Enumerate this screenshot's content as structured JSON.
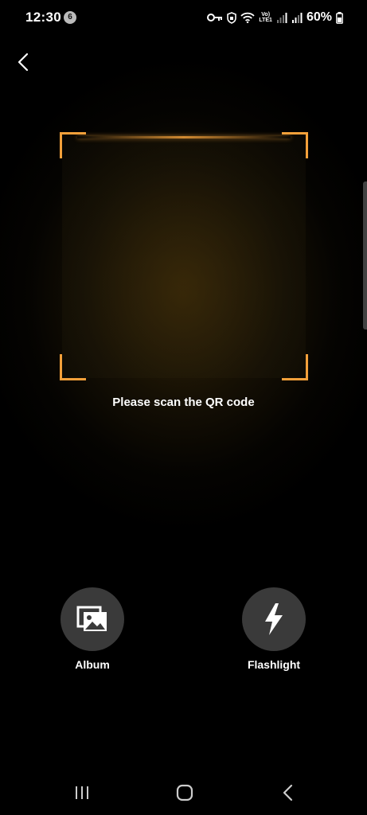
{
  "status_bar": {
    "time": "12:30",
    "notification_count": "6",
    "network_label": "Vo)\nLTE1",
    "battery_percent": "60%"
  },
  "scanner": {
    "hint": "Please scan the QR code",
    "accent_color": "#f3a03a"
  },
  "actions": {
    "album_label": "Album",
    "album_icon": "gallery-icon",
    "flashlight_label": "Flashlight",
    "flashlight_icon": "lightning-bolt-icon"
  },
  "nav_bar": {
    "recents_icon": "recents-icon",
    "home_icon": "home-icon",
    "back_icon": "back-icon"
  }
}
